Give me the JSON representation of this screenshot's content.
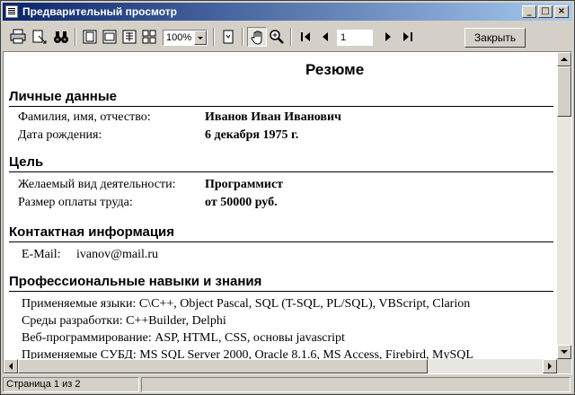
{
  "window": {
    "title": "Предварительный просмотр"
  },
  "toolbar": {
    "zoom_value": "100%",
    "page_value": "1",
    "close_label": "Закрыть"
  },
  "document": {
    "title": "Резюме",
    "sections": {
      "personal": {
        "heading": "Личные данные",
        "rows": [
          {
            "label": "Фамилия, имя, отчество:",
            "value": "Иванов Иван Иванович"
          },
          {
            "label": "Дата рождения:",
            "value": "6 декабря 1975 г."
          }
        ]
      },
      "goal": {
        "heading": "Цель",
        "rows": [
          {
            "label": "Желаемый вид деятельности:",
            "value": "Программист"
          },
          {
            "label": "Размер оплаты труда:",
            "value": "от 50000 руб."
          }
        ]
      },
      "contact": {
        "heading": "Контактная информация",
        "email_label": "E-Mail:",
        "email_value": "ivanov@mail.ru"
      },
      "skills": {
        "heading": "Профессиональные навыки и знания",
        "lines": [
          "Применяемые языки: C\\C++, Object Pascal, SQL (T-SQL, PL/SQL), VBScript, Clarion",
          "Среды разработки: C++Builder, Delphi",
          "Веб-программирование: ASP, HTML, CSS, основы javascript",
          "Применяемые СУБД: MS SQL Server 2000, Oracle 8.1.6, MS Access, Firebird, MySQL"
        ]
      }
    }
  },
  "status": {
    "page_info": "Страница 1 из 2"
  }
}
